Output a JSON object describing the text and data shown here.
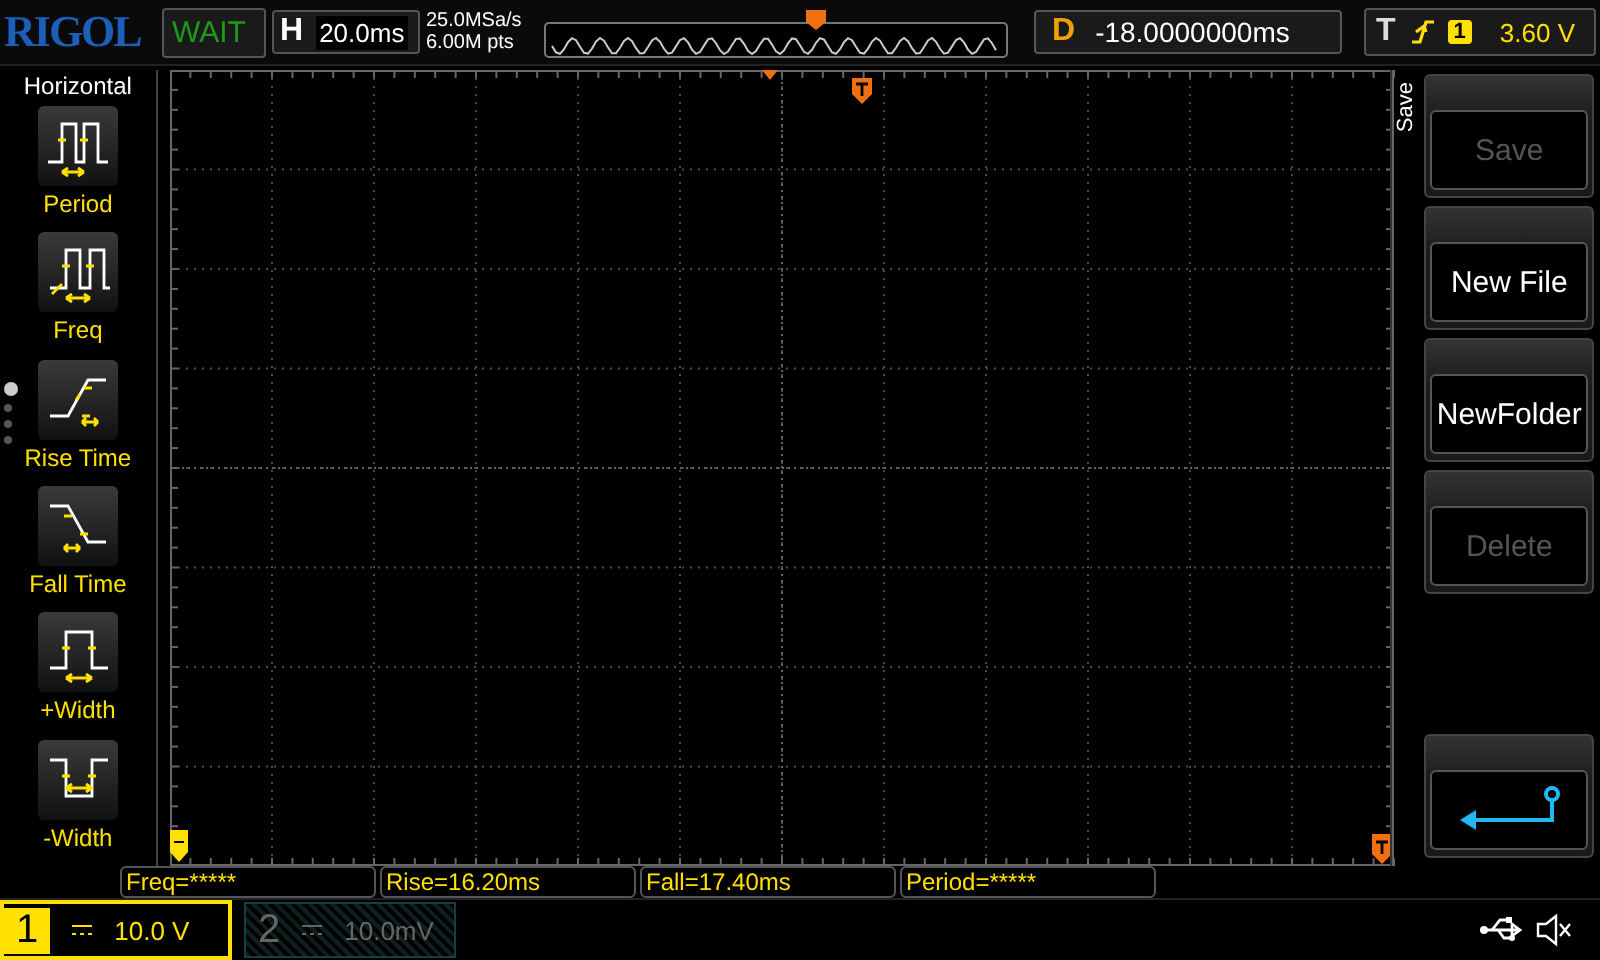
{
  "brand": "RIGOL",
  "run_state": "WAIT",
  "horizontal": {
    "label": "H",
    "timebase": "20.0ms"
  },
  "sample": {
    "rate": "25.0MSa/s",
    "points": "6.00M pts"
  },
  "delay": {
    "label": "D",
    "value": "-18.0000000ms"
  },
  "trigger": {
    "label": "T",
    "source": "1",
    "level": "3.60 V"
  },
  "measure_menu": {
    "title": "Horizontal",
    "items": [
      {
        "label": "Period",
        "kind": "period"
      },
      {
        "label": "Freq",
        "kind": "freq"
      },
      {
        "label": "Rise Time",
        "kind": "rise"
      },
      {
        "label": "Fall Time",
        "kind": "fall"
      },
      {
        "label": "+Width",
        "kind": "pwidth"
      },
      {
        "label": "-Width",
        "kind": "nwidth"
      }
    ],
    "pages": [
      {
        "selected": true
      },
      {
        "selected": false
      },
      {
        "selected": false
      },
      {
        "selected": false
      }
    ]
  },
  "softkeys": {
    "title": "Save",
    "items": [
      {
        "kind": "text",
        "label": "Save",
        "disabled": true
      },
      {
        "kind": "text",
        "label": "New File",
        "disabled": false
      },
      {
        "kind": "text",
        "label": "NewFolder",
        "disabled": false
      },
      {
        "kind": "text",
        "label": "Delete",
        "disabled": true
      },
      {
        "kind": "back"
      }
    ]
  },
  "measurements": [
    "Freq=*****",
    "Rise=16.20ms",
    "Fall=17.40ms",
    "Period=*****"
  ],
  "channels": [
    {
      "number": "1",
      "scale": "10.0 V",
      "on": true
    },
    {
      "number": "2",
      "scale": "10.0mV",
      "on": false
    }
  ]
}
